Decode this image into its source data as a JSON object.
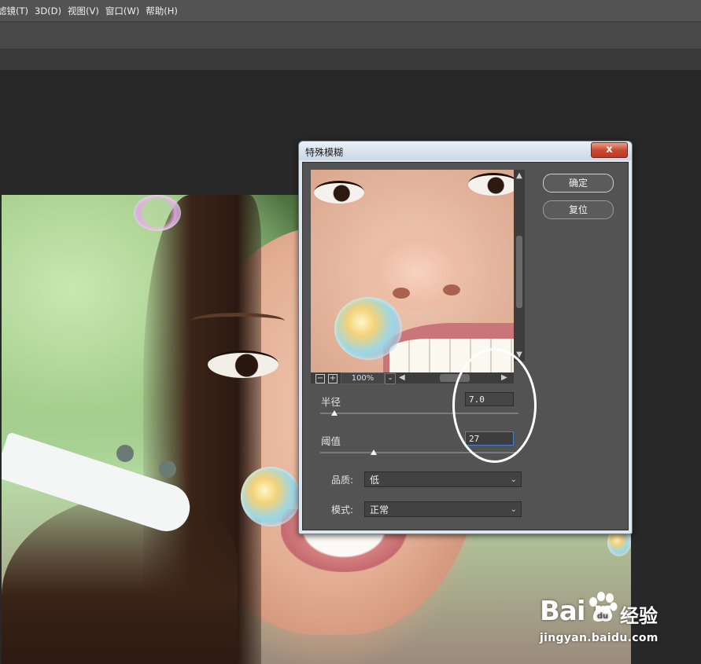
{
  "menu": {
    "items": [
      "滤镜(T)",
      "3D(D)",
      "视图(V)",
      "窗口(W)",
      "帮助(H)"
    ]
  },
  "dialog": {
    "title": "特殊模糊",
    "close_label": "x",
    "ok_label": "确定",
    "reset_label": "复位",
    "zoom": {
      "minus_label": "−",
      "plus_label": "+",
      "value": "100%",
      "dropdown_label": "⌄"
    },
    "radius": {
      "label": "半径",
      "value": "7.0",
      "slider_fraction": 0.07
    },
    "threshold": {
      "label": "阈值",
      "value": "27",
      "slider_fraction": 0.27
    },
    "quality": {
      "label": "品质:",
      "value": "低"
    },
    "mode": {
      "label": "模式:",
      "value": "正常"
    }
  },
  "watermark": {
    "brand": "Bai  u",
    "cn": "经验",
    "url": "jingyan.baidu.com"
  },
  "colors": {
    "accent_focus": "#4a7fd0",
    "close_button": "#c94a33",
    "panel": "#535353"
  }
}
